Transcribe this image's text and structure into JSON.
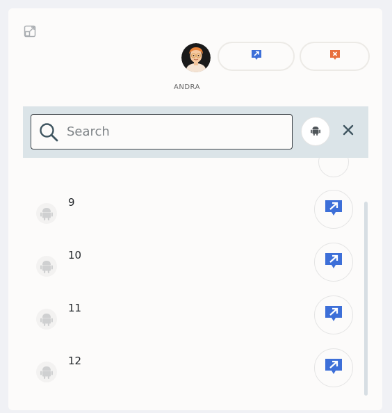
{
  "header": {
    "username": "ANDRA",
    "expand_icon": "expand-icon",
    "action_buttons": [
      {
        "icon": "share-chat-icon",
        "color": "#3d6fd8"
      },
      {
        "icon": "close-chat-icon",
        "color": "#e8703e"
      }
    ]
  },
  "search": {
    "placeholder": "Search",
    "value": ""
  },
  "list": {
    "items": [
      {
        "label": "9"
      },
      {
        "label": "10"
      },
      {
        "label": "11"
      },
      {
        "label": "12"
      }
    ]
  },
  "colors": {
    "accent": "#3d6fd8",
    "danger": "#e8703e",
    "search_bg": "#dbe4e8"
  }
}
